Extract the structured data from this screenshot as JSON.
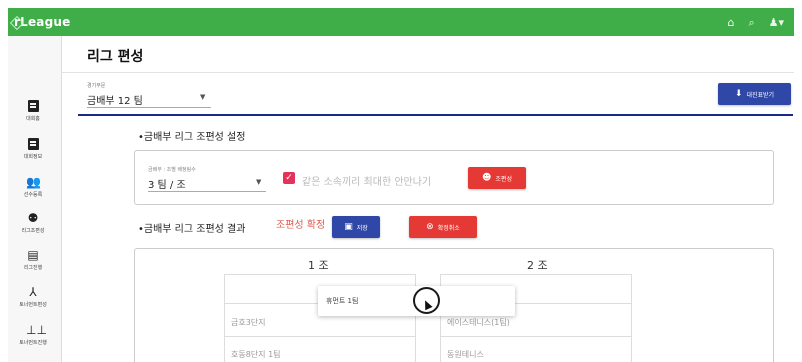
{
  "app": {
    "brand": "rLeague",
    "header_icons": [
      "home-icon",
      "search-icon",
      "user-icon"
    ]
  },
  "sidebar": {
    "items": [
      {
        "label": "대회홈",
        "icon": "document-icon"
      },
      {
        "label": "대회정보",
        "icon": "document-icon"
      },
      {
        "label": "선수등록",
        "icon": "add-user-icon"
      },
      {
        "label": "리그조편성",
        "icon": "team-icon"
      },
      {
        "label": "리그진행",
        "icon": "clipboard-icon"
      },
      {
        "label": "토너먼트편성",
        "icon": "tournament-icon"
      },
      {
        "label": "토너먼트진행",
        "icon": "bracket-icon"
      }
    ]
  },
  "page": {
    "title": "리그 편성",
    "division_select": {
      "label": "경기부문",
      "value": "금배부  12 팀"
    },
    "download_button": "대진표받기",
    "section1_title": "•금배부 리그 조편성 설정",
    "settings": {
      "per_group_label": "금배부 : 조별 배정팀수",
      "per_group_value": "3 팀 / 조",
      "same_club_label": "같은 소속끼리 최대한 안만나기",
      "shuffle_button": "조편성"
    },
    "section2_title": "•금배부 리그 조편성 결과",
    "confirmed_text": "조편성 확정",
    "save_button": "저장",
    "cancel_button": "확정취소",
    "groups": [
      {
        "title": "1 조",
        "rows": [
          "",
          "금호3단지",
          "호동8단지 1팀"
        ]
      },
      {
        "title": "2 조",
        "rows": [
          "",
          "에이스테니스(1팀)",
          "동원테니스"
        ]
      }
    ],
    "dragging_item": "휴먼트 1팀"
  },
  "colors": {
    "appbar": "#3fae49",
    "primary": "#2f48a8",
    "danger": "#e53935",
    "checkbox": "#e2335b"
  }
}
